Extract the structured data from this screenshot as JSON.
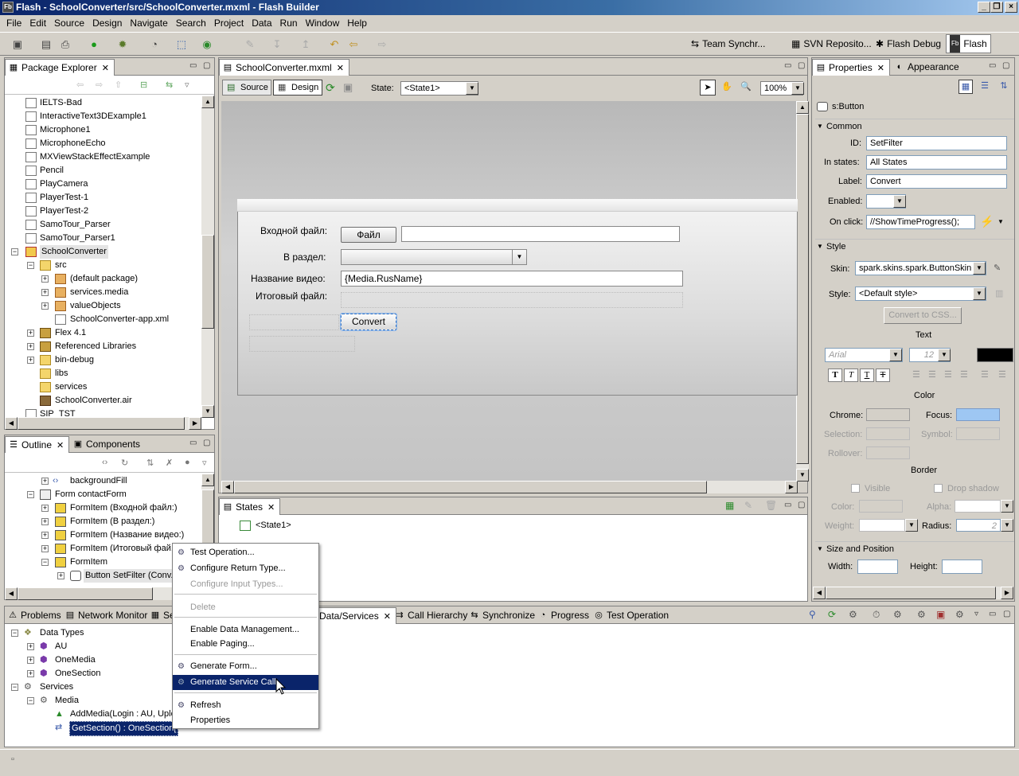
{
  "window": {
    "title": "Flash - SchoolConverter/src/SchoolConverter.mxml - Flash Builder",
    "app_icon": "Fb"
  },
  "menubar": [
    "File",
    "Edit",
    "Source",
    "Design",
    "Navigate",
    "Search",
    "Project",
    "Data",
    "Run",
    "Window",
    "Help"
  ],
  "perspectives": [
    "Team Synchr...",
    "SVN Reposito...",
    "Flash Debug",
    "Flash"
  ],
  "package_explorer": {
    "tab": "Package Explorer",
    "items": [
      "IELTS-Bad",
      "InteractiveText3DExample1",
      "Microphone1",
      "MicrophoneEcho",
      "MXViewStackEffectExample",
      "Pencil",
      "PlayCamera",
      "PlayerTest-1",
      "PlayerTest-2",
      "SamoTour_Parser",
      "SamoTour_Parser1",
      "SchoolConverter",
      "src",
      "(default package)",
      "services.media",
      "valueObjects",
      "SchoolConverter-app.xml",
      "Flex 4.1",
      "Referenced Libraries",
      "bin-debug",
      "libs",
      "services",
      "SchoolConverter.air",
      "SIP_TST"
    ]
  },
  "outline": {
    "tabs": [
      "Outline",
      "Components"
    ],
    "items": [
      "backgroundFill",
      "Form contactForm",
      "FormItem (Входной файл:)",
      "FormItem (В раздел:)",
      "FormItem (Название видео:)",
      "FormItem (Итоговый фай...",
      "FormItem",
      "Button SetFilter (Conv..."
    ]
  },
  "editor": {
    "tab": "SchoolConverter.mxml",
    "source": "Source",
    "design": "Design",
    "state_label": "State:",
    "state_value": "<State1>",
    "zoom": "100%"
  },
  "form": {
    "input_file_label": "Входной файл:",
    "file_button": "Файл",
    "section_label": "В раздел:",
    "video_name_label": "Название видео:",
    "video_name_value": "{Media.RusName}",
    "result_label": "Итоговый файл:",
    "convert_button": "Convert"
  },
  "states": {
    "tab": "States",
    "item": "<State1>"
  },
  "properties": {
    "tabs": [
      "Properties",
      "Appearance"
    ],
    "component": "s:Button",
    "common": "Common",
    "id_label": "ID:",
    "id_value": "SetFilter",
    "in_states_label": "In states:",
    "in_states_value": "All States",
    "label_label": "Label:",
    "label_value": "Convert",
    "enabled_label": "Enabled:",
    "onclick_label": "On click:",
    "onclick_value": "//ShowTimeProgress();",
    "style": "Style",
    "skin_label": "Skin:",
    "skin_value": "spark.skins.spark.ButtonSkin",
    "style_label": "Style:",
    "style_value": "<Default style>",
    "convert_css": "Convert to CSS...",
    "text": "Text",
    "font": "Arial",
    "font_size": "12",
    "color": "Color",
    "chrome": "Chrome:",
    "focus": "Focus:",
    "selection": "Selection:",
    "symbol": "Symbol:",
    "rollover": "Rollover:",
    "border": "Border",
    "visible": "Visible",
    "drop_shadow": "Drop shadow",
    "color_label": "Color:",
    "alpha": "Alpha:",
    "weight": "Weight:",
    "radius": "Radius:",
    "radius_value": "2",
    "size_position": "Size and Position",
    "width": "Width:",
    "height": "Height:"
  },
  "bottom": {
    "tabs": [
      "Problems",
      "Network Monitor",
      "Se",
      "Data/Services",
      "Call Hierarchy",
      "Synchronize",
      "Progress",
      "Test Operation"
    ],
    "tree": [
      "Data Types",
      "AU",
      "OneMedia",
      "OneSection",
      "Services",
      "Media",
      "AddMedia(Login : AU, Uplo",
      "GetSection() : OneSection["
    ]
  },
  "context_menu": [
    "Test Operation...",
    "Configure Return Type...",
    "Configure Input Types...",
    "Delete",
    "Enable Data Management...",
    "Enable Paging...",
    "Generate Form...",
    "Generate Service Call",
    "Refresh",
    "Properties"
  ],
  "colors": {
    "title_bar": "#0a246a",
    "selection": "#0a246a",
    "focus_color": "#9ec7f3"
  }
}
